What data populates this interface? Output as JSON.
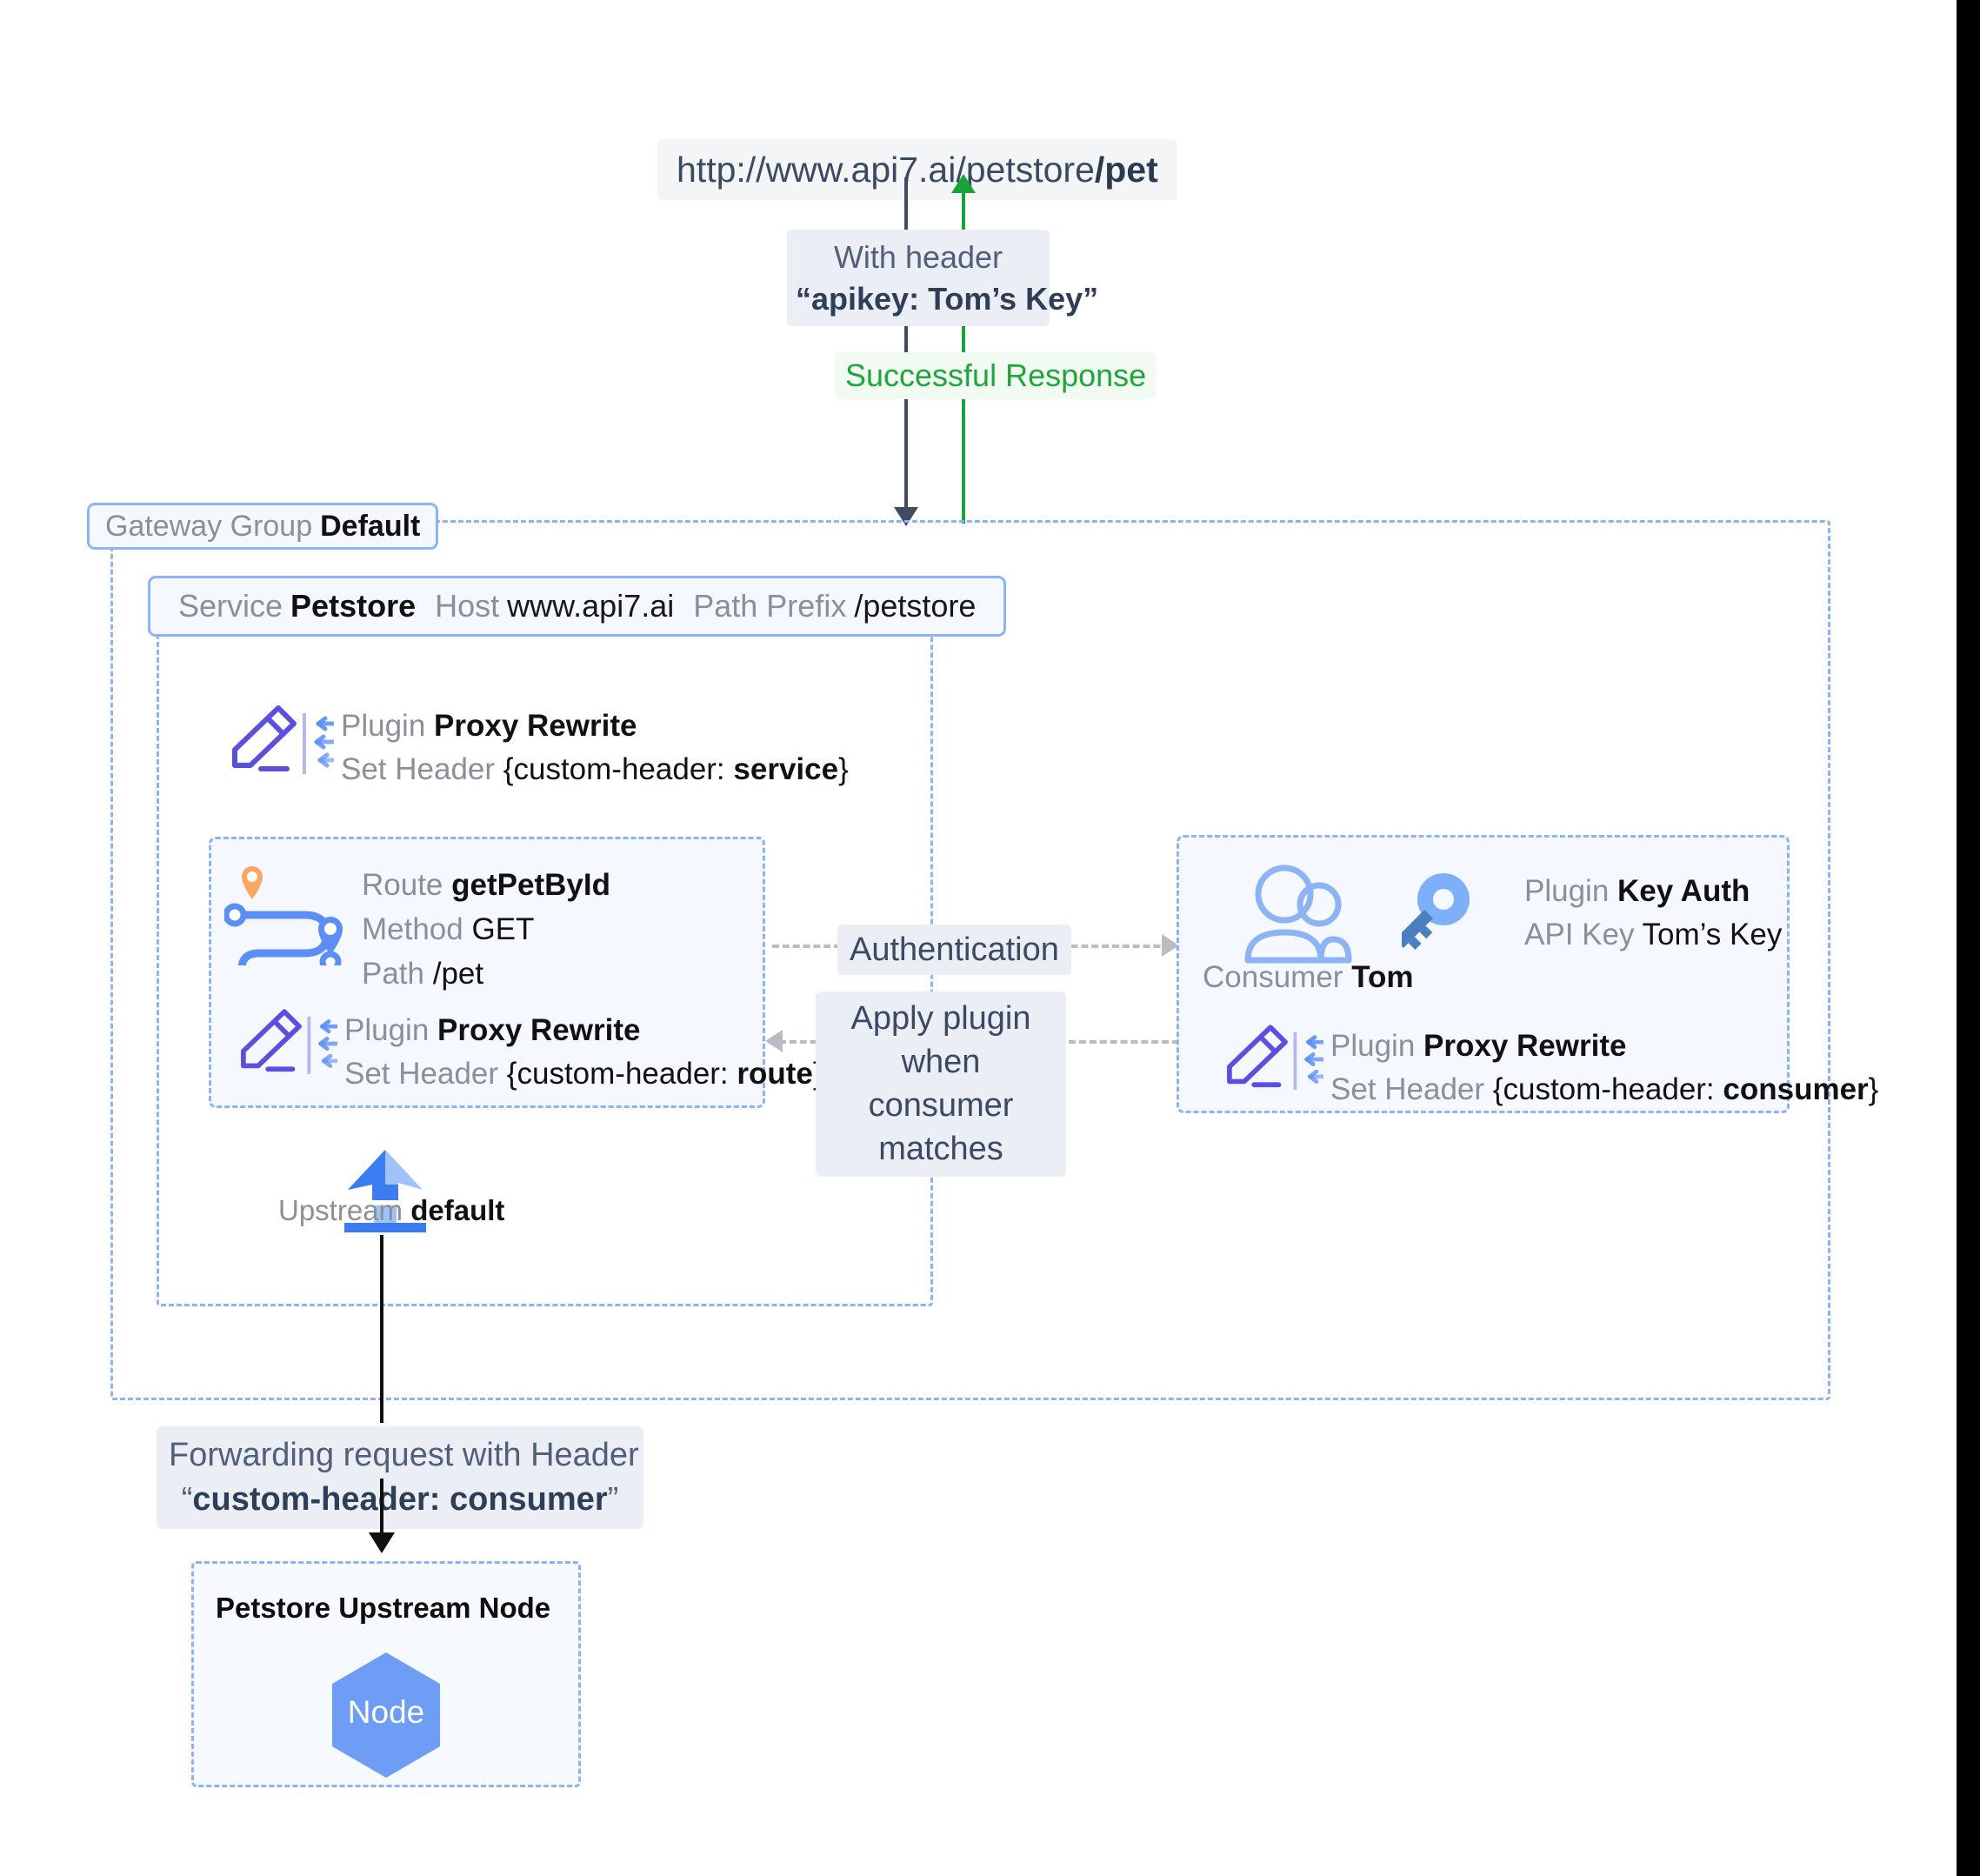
{
  "flow": {
    "url": {
      "prefix": "http://www.api7.ai/petstore",
      "bold": "/pet"
    },
    "request_header": {
      "line1": "With header",
      "line2": "“apikey: Tom’s Key”"
    },
    "response_label": "Successful Response"
  },
  "gateway_group": {
    "key": "Gateway Group",
    "value": "Default"
  },
  "service": {
    "key": "Service",
    "value": "Petstore",
    "host_key": "Host",
    "host_value": "www.api7.ai",
    "path_prefix_key": "Path Prefix",
    "path_prefix_value": "/petstore",
    "plugin": {
      "plugin_key": "Plugin",
      "plugin_value": "Proxy Rewrite",
      "set_header_key": "Set Header",
      "set_header_value": "{custom-header: ",
      "set_header_bold": "service",
      "set_header_tail": "}"
    }
  },
  "route": {
    "route_key": "Route",
    "route_value": "getPetById",
    "method_key": "Method",
    "method_value": "GET",
    "path_key": "Path",
    "path_value": "/pet",
    "plugin": {
      "plugin_key": "Plugin",
      "plugin_value": "Proxy Rewrite",
      "set_header_key": "Set Header",
      "set_header_value": "{custom-header: ",
      "set_header_bold": "route",
      "set_header_tail": "}"
    }
  },
  "consumer": {
    "consumer_key": "Consumer",
    "consumer_value": "Tom",
    "key_auth": {
      "plugin_key": "Plugin",
      "plugin_value": "Key Auth",
      "api_key_key": "API Key",
      "api_key_value": "Tom’s Key"
    },
    "plugin": {
      "plugin_key": "Plugin",
      "plugin_value": "Proxy Rewrite",
      "set_header_key": "Set Header",
      "set_header_value": "{custom-header: ",
      "set_header_bold": "consumer",
      "set_header_tail": "}"
    }
  },
  "connectors": {
    "authentication": "Authentication",
    "apply_plugin_line1": "Apply plugin when",
    "apply_plugin_line2": "consumer matches"
  },
  "upstream": {
    "key": "Upstream",
    "value": "default"
  },
  "forwarding": {
    "line1": "Forwarding request with Header",
    "line2_quote_open": "“",
    "line2_bold": "custom-header: consumer",
    "line2_quote_close": "”"
  },
  "node": {
    "title": "Petstore Upstream Node",
    "hex_label": "Node"
  },
  "colors": {
    "accent_blue": "#5B8EF7",
    "dashed_blue": "#8CB4F5",
    "purple": "#5B4FE0",
    "green": "#1AA336",
    "orange_pin": "#F9A864",
    "dark_slate": "#3E4B63",
    "muted_gray": "#8A8F99"
  }
}
